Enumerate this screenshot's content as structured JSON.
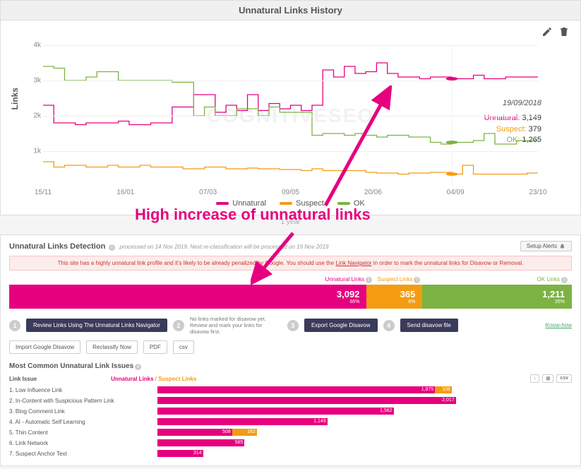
{
  "colors": {
    "unnatural": "#e6007e",
    "suspect": "#f39c12",
    "ok": "#7cb342"
  },
  "chart": {
    "title": "Unnatural Links History",
    "ylabel": "Links",
    "watermark": "COGNITIVESEO",
    "annotation": "High increase of unnatural links",
    "tooltip": {
      "date": "19/09/2018",
      "unnatural_label": "Unnatural:",
      "unnatural_val": "3,149",
      "suspect_label": "Suspect:",
      "suspect_val": "379",
      "ok_label": "OK:",
      "ok_val": "1,265"
    },
    "legend": {
      "unnatural": "Unnatural",
      "suspect": "Suspect",
      "ok": "OK"
    },
    "timespan_label": "1 year"
  },
  "chart_data": {
    "type": "line",
    "xlabel": "",
    "ylabel": "Links",
    "ylim": [
      0,
      4000
    ],
    "y_ticks": [
      1000,
      2000,
      3000,
      4000
    ],
    "x_categories": [
      "15/11",
      "16/01",
      "07/03",
      "09/05",
      "20/06",
      "04/09",
      "23/10"
    ],
    "series": [
      {
        "name": "Unnatural",
        "color": "#e6007e",
        "values": [
          2300,
          1800,
          1800,
          1750,
          1800,
          1800,
          1800,
          1850,
          1750,
          1750,
          1800,
          1800,
          2250,
          2250,
          2600,
          2600,
          2100,
          2300,
          2150,
          2600,
          2150,
          2350,
          2200,
          2300,
          2150,
          2300,
          3300,
          3100,
          3400,
          3200,
          3250,
          3500,
          3200,
          3100,
          3100,
          3050,
          3100,
          3100,
          3050,
          3050,
          3150,
          3050,
          3050,
          3100,
          3100,
          3100,
          3100
        ]
      },
      {
        "name": "Suspect",
        "color": "#f39c12",
        "values": [
          700,
          550,
          600,
          600,
          550,
          550,
          600,
          550,
          550,
          600,
          550,
          550,
          550,
          500,
          500,
          550,
          550,
          500,
          500,
          520,
          500,
          500,
          480,
          480,
          450,
          500,
          450,
          450,
          450,
          450,
          400,
          380,
          380,
          350,
          380,
          380,
          400,
          400,
          350,
          600,
          350,
          350,
          350,
          350,
          350,
          380,
          380
        ]
      },
      {
        "name": "OK",
        "color": "#7cb342",
        "values": [
          3400,
          3350,
          3000,
          3000,
          3100,
          3250,
          3250,
          3000,
          3000,
          3000,
          3000,
          3000,
          2950,
          2950,
          2000,
          2250,
          2000,
          2000,
          2200,
          2200,
          2000,
          2250,
          2100,
          2100,
          2100,
          1450,
          1500,
          1500,
          1450,
          1500,
          1450,
          1400,
          1450,
          1450,
          1400,
          1400,
          1250,
          1200,
          1250,
          1250,
          1300,
          1500,
          1200,
          1200,
          1300,
          1300,
          1300
        ]
      }
    ],
    "tooltip_point_index": 38
  },
  "detection": {
    "title": "Unnatural Links Detection",
    "subtitle": "processed on 14 Nov 2019. Next re-classification will be processed on 19 Nov 2019",
    "setup_alerts": "Setup Alerts",
    "warning_pre": "This site has a highly unnatural link profile and it's likely to be already penalized by Google. You should use the ",
    "warning_link": "Link Navigator",
    "warning_post": " in order to mark the unnatural links for Disavow or Removal.",
    "segments": {
      "unnatural": {
        "label": "Unnatural Links",
        "count": "3,092",
        "pct": "66%",
        "width": 66
      },
      "suspect": {
        "label": "Suspect Links",
        "count": "365",
        "pct": "8%",
        "width": 8
      },
      "ok": {
        "label": "OK Links",
        "count": "1,211",
        "pct": "26%",
        "width": 26
      }
    },
    "actions": {
      "one": "1",
      "two": "2",
      "three": "3",
      "four": "4",
      "review_btn": "Review Links Using The Unnatural Links Navigator",
      "no_marks": "No links marked for disavow yet. Review and mark your links for disavow first.",
      "export_btn": "Export Google Disavow",
      "send_btn": "Send disavow file",
      "know_how": "Know-how",
      "import_btn": "Import Google Disavow",
      "reclass_btn": "Reclassify Now",
      "pdf": "PDF",
      "csv": "csv"
    },
    "issues_title": "Most Common Unnatural Link Issues",
    "issues_head_label": "Link Issue",
    "issues_head_un": "Unnatural Links",
    "issues_head_sus": " / Suspect Links",
    "dl": {
      "a": "↓",
      "b": "⊞",
      "c": "csv"
    },
    "issues": [
      {
        "n": "1",
        "label": "Low Influence Link",
        "un_w": 67,
        "un_v": "1,875",
        "sus_w": 4,
        "sus_v": "108"
      },
      {
        "n": "2",
        "label": "In-Content with Suspicious Pattern Link",
        "un_w": 72,
        "un_v": "2,017",
        "sus_w": 0,
        "sus_v": ""
      },
      {
        "n": "3",
        "label": "Blog Comment Link",
        "un_w": 57,
        "un_v": "1,582",
        "sus_w": 0,
        "sus_v": ""
      },
      {
        "n": "4",
        "label": "AI - Automatic Self Learning",
        "un_w": 41,
        "un_v": "1,149",
        "sus_w": 0,
        "sus_v": ""
      },
      {
        "n": "5",
        "label": "Thin Content",
        "un_w": 18,
        "un_v": "508",
        "sus_w": 6,
        "sus_v": "162"
      },
      {
        "n": "6",
        "label": "Link Network",
        "un_w": 21,
        "un_v": "585",
        "sus_w": 0,
        "sus_v": ""
      },
      {
        "n": "7",
        "label": "Suspect Anchor Text",
        "un_w": 11,
        "un_v": "314",
        "sus_w": 0,
        "sus_v": ""
      }
    ]
  }
}
